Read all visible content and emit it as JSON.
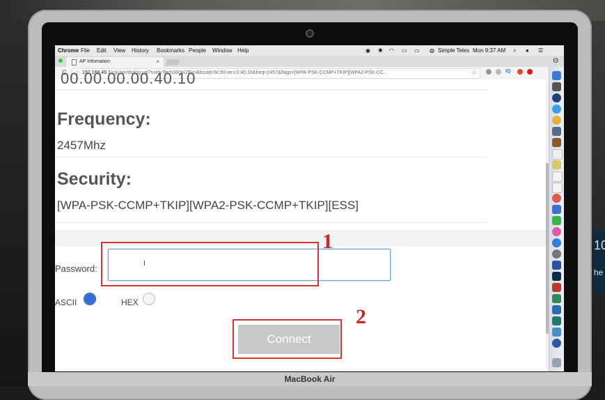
{
  "menubar": {
    "app": "Chrome",
    "items": [
      "File",
      "Edit",
      "View",
      "History",
      "Bookmarks",
      "People",
      "Window",
      "Help"
    ],
    "right_text": "Simple Telex",
    "clock": "Mon 9:37 AM"
  },
  "tab": {
    "title": "AP Infomation",
    "close": "×"
  },
  "address": {
    "url_host": "192.168.49.1",
    "url_path": "/cgi-bin/dialog.cgi?ssid=Tech360%2Evn&bssid=9c:50:ee:c3:40:10&freq=2457&flags=[WPA-PSK-CCMP+TKIP][WPA2-PSK-CC..."
  },
  "page": {
    "cut_text": "00.00.00.00.40.10",
    "frequency_heading": "Frequency:",
    "frequency_value": "2457Mhz",
    "security_heading": "Security:",
    "security_value": "[WPA-PSK-CCMP+TKIP][WPA2-PSK-CCMP+TKIP][ESS]",
    "password_label": "Password:",
    "password_value": "",
    "ascii_label": "ASCII",
    "hex_label": "HEX",
    "connect_label": "Connect",
    "annotation_1": "1",
    "annotation_2": "2"
  },
  "laptop_label": "MacBook Air",
  "right_sign": {
    "line1": "10",
    "line2": "he"
  },
  "colors": {
    "annotation_red": "#d6342c",
    "radio_selected": "#2f6fd6",
    "connect_bg": "#c8c8c8"
  }
}
